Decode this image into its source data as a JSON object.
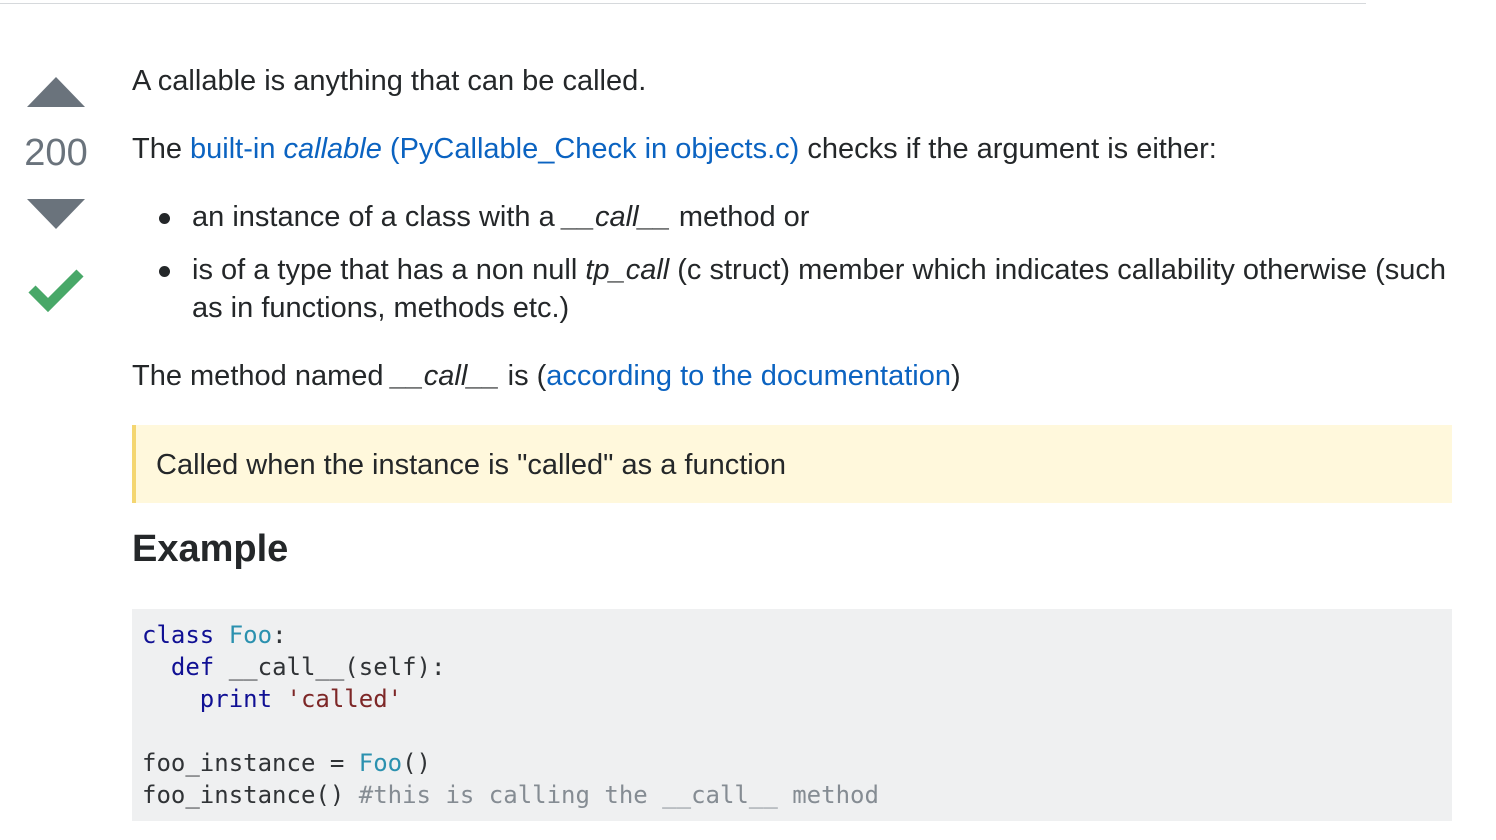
{
  "vote": {
    "count": "200",
    "upvote_icon": "triangle-up-icon",
    "downvote_icon": "triangle-down-icon",
    "accepted_icon": "checkmark-icon",
    "accepted_color": "#48a868"
  },
  "answer": {
    "p1": "A callable is anything that can be called.",
    "p2": {
      "pre": "The ",
      "link1_a": "built-in ",
      "link1_italic": "callable",
      "link1_b": " (PyCallable_Check in objects.c)",
      "post": " checks if the argument is either:"
    },
    "bullets": [
      {
        "pre": "an instance of a class with a ",
        "italic": "__call__",
        "post": " method or"
      },
      {
        "pre": "is of a type that has a non null ",
        "italic": "tp_call",
        "post": " (c struct) member which indicates callability otherwise (such as in functions, methods etc.)"
      }
    ],
    "p3": {
      "pre": "The method named ",
      "italic": "__call__",
      "mid": " is (",
      "link": "according to the documentation",
      "post": ")"
    },
    "quote": "Called when the instance is \"called\" as a function",
    "heading": "Example",
    "code": {
      "l1_kw": "class",
      "l1_cls": "Foo",
      "l1_rest": ":",
      "l2_indent": "  ",
      "l2_kw": "def",
      "l2_rest": " __call__(self):",
      "l3_indent": "    ",
      "l3_kw": "print",
      "l3_str": "'called'",
      "l5_pre": "foo_instance = ",
      "l5_cls": "Foo",
      "l5_post": "()",
      "l6_pre": "foo_instance() ",
      "l6_cmt": "#this is calling the __call__ method"
    }
  },
  "colors": {
    "link": "#0b63c1",
    "text": "#242729",
    "vote_gray": "#6a737c",
    "quote_bg": "#fff8dc",
    "quote_border": "#f4d671",
    "code_bg": "#eff0f1"
  }
}
